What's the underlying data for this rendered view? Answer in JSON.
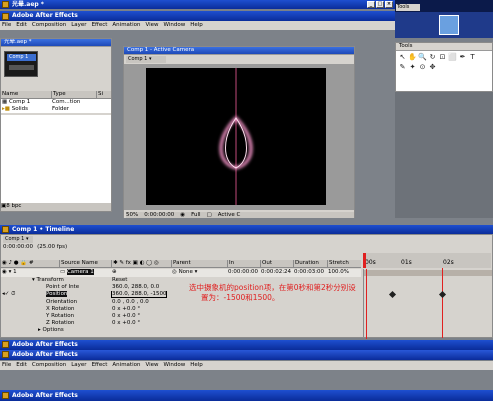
{
  "app": {
    "title": "Adobe After Effects",
    "menus": [
      "File",
      "Edit",
      "Composition",
      "Layer",
      "Effect",
      "Animation",
      "View",
      "Window",
      "Help"
    ]
  },
  "project": {
    "title": "光晕.aep *",
    "comp_thumb_label": "Comp 1",
    "columns": [
      "Name",
      "Type",
      "Si"
    ],
    "items": [
      {
        "name": "Comp 1",
        "type": "Com...tion"
      },
      {
        "name": "Solids",
        "type": "Folder"
      }
    ],
    "bpc": "8 bpc"
  },
  "viewer": {
    "title": "Comp 1 - Active Camera",
    "tab": "Comp 1 ▾",
    "zoom": "50%",
    "time": "0:00:00:00",
    "resolution": "Full",
    "camera": "Active C"
  },
  "tools": {
    "title": "Tools",
    "glyphs": [
      "↖",
      "✋",
      "🔍",
      "↻",
      "⊡",
      "⬜",
      "✒",
      "T",
      "✎",
      "✦",
      "⊙",
      "✥"
    ]
  },
  "timeline": {
    "title": "Comp 1 • Timeline",
    "tab": "Comp 1 ▾",
    "timecode": "0:00:00:00",
    "fps": "(25.00 fps)",
    "columns": {
      "source": "Source Name",
      "parent": "Parent",
      "in": "In",
      "out": "Out",
      "duration": "Duration",
      "stretch": "Stretch"
    },
    "ruler": [
      "00s",
      "01s",
      "02s"
    ],
    "layer": {
      "num": "1",
      "name": "Camera 1",
      "parent": "None",
      "in": "0:00:00:00",
      "out": "0:00:02:24",
      "duration": "0:00:03:00",
      "stretch": "100.0%"
    },
    "props": [
      {
        "name": "Transform",
        "value": "Reset"
      },
      {
        "name": "Point of Inte",
        "value": "360.0, 288.0, 0.0"
      },
      {
        "name": "Position",
        "value": "360.0, 288.0, -1500"
      },
      {
        "name": "Orientation",
        "value": "0.0 , 0.0 , 0.0"
      },
      {
        "name": "X Rotation",
        "value": "0 x +0.0 °"
      },
      {
        "name": "Y Rotation",
        "value": "0 x +0.0 °"
      },
      {
        "name": "Z Rotation",
        "value": "0 x +0.0 °"
      },
      {
        "name": "Options",
        "value": ""
      }
    ],
    "annotation_line1": "选中摄象机的position项，在第0秒和第2秒分别设",
    "annotation_line2": "置为：-1500和1500。"
  },
  "taskbars": [
    "Adobe After Effects",
    "Adobe After Effects",
    "Adobe After Effects"
  ]
}
